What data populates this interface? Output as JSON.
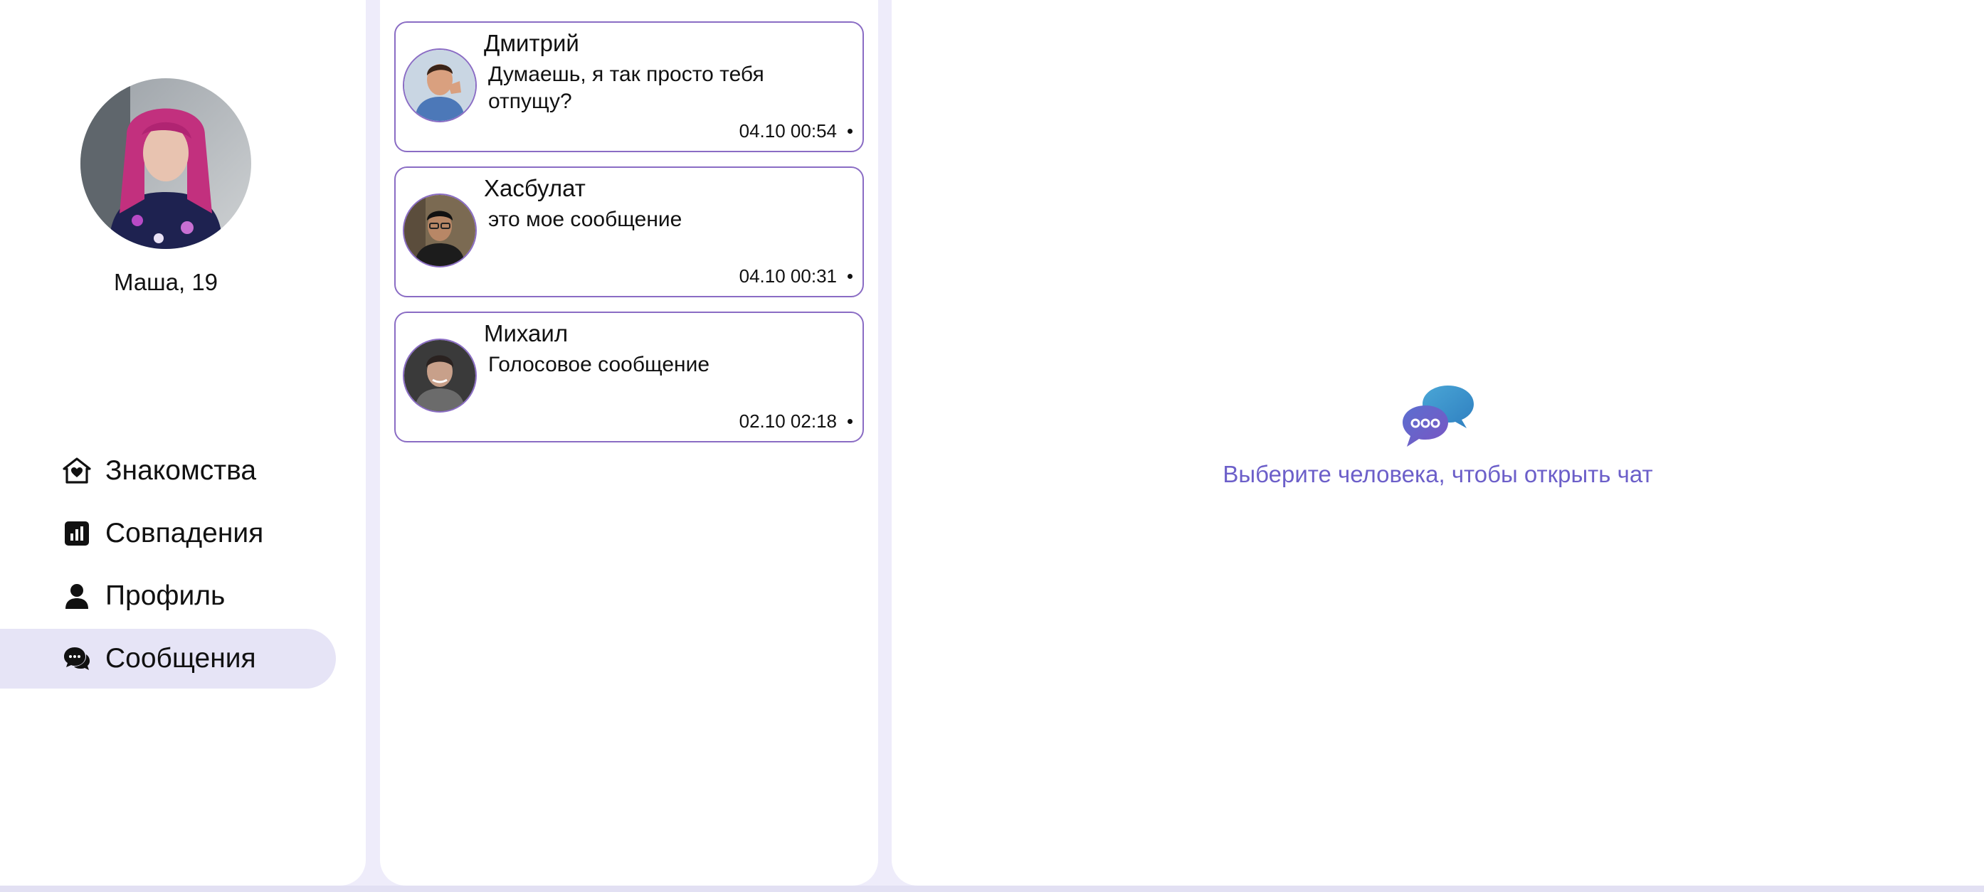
{
  "profile": {
    "name": "Маша, 19",
    "avatar_icon": "user-photo-avatar"
  },
  "nav": {
    "items": [
      {
        "label": "Знакомства",
        "icon": "home-heart-icon"
      },
      {
        "label": "Совпадения",
        "icon": "bar-chart-icon"
      },
      {
        "label": "Профиль",
        "icon": "person-icon"
      },
      {
        "label": "Сообщения",
        "icon": "chat-bubbles-icon",
        "active": true
      }
    ]
  },
  "chats": [
    {
      "name": "Дмитрий",
      "message": "Думаешь, я так просто тебя отпущу?",
      "time": "04.10 00:54"
    },
    {
      "name": "Хасбулат",
      "message": "это мое сообщение",
      "time": "04.10 00:31"
    },
    {
      "name": "Михаил",
      "message": "Голосовое сообщение",
      "time": "02.10 02:18"
    }
  ],
  "chat_view": {
    "empty_text": "Выберите человека, чтобы открыть чат",
    "empty_icon": "chat-bubbles-icon"
  },
  "colors": {
    "accent": "#6c5fc9",
    "card_border": "#8a6cc4",
    "nav_active": "#e6e4f6",
    "background": "#eeecfa"
  }
}
